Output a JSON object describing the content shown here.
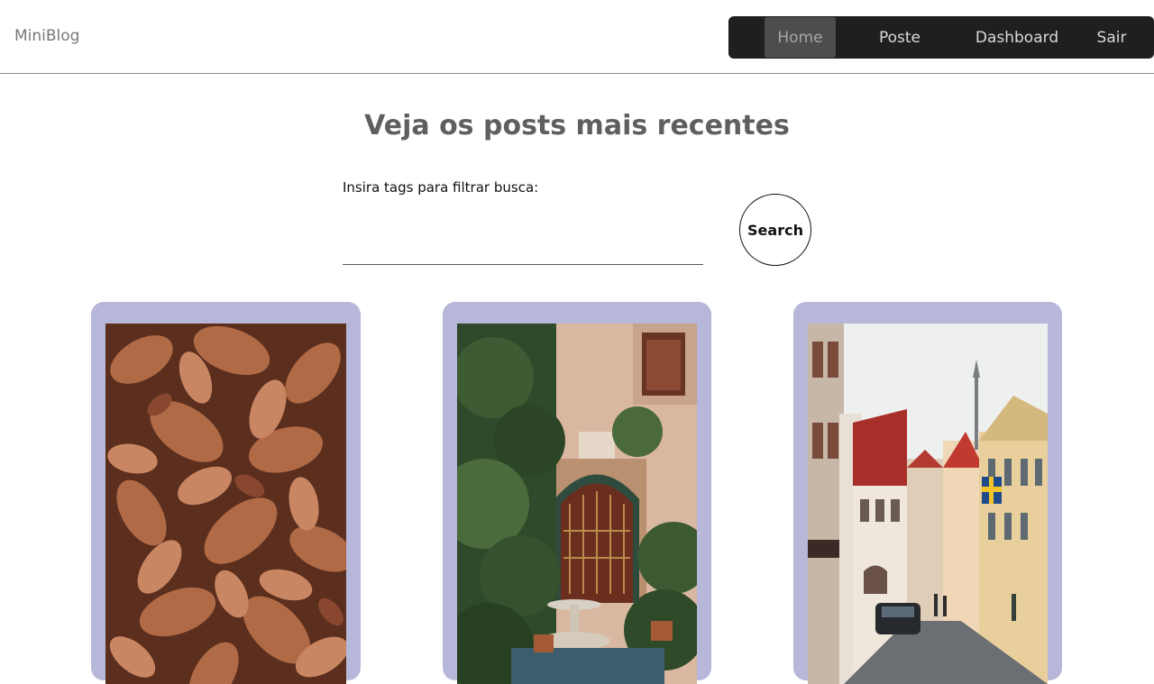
{
  "navbar": {
    "brand": "MiniBlog",
    "links": [
      {
        "label": "Home",
        "active": true
      },
      {
        "label": "Poste",
        "active": false
      },
      {
        "label": "Dashboard",
        "active": false
      },
      {
        "label": "Sair",
        "active": false
      }
    ]
  },
  "main": {
    "title": "Veja os posts mais recentes",
    "search": {
      "label": "Insira tags para filtrar busca:",
      "value": "",
      "placeholder": "",
      "button_label": "Search"
    },
    "posts": [
      {
        "image": "autumn-leaves-photo"
      },
      {
        "image": "courtyard-garden-photo"
      },
      {
        "image": "old-town-street-photo"
      }
    ]
  },
  "colors": {
    "nav_background": "#1f1f1f",
    "nav_active": "#4d4d4d",
    "card_background": "#b7b7d9",
    "title": "#5f5f5f"
  }
}
